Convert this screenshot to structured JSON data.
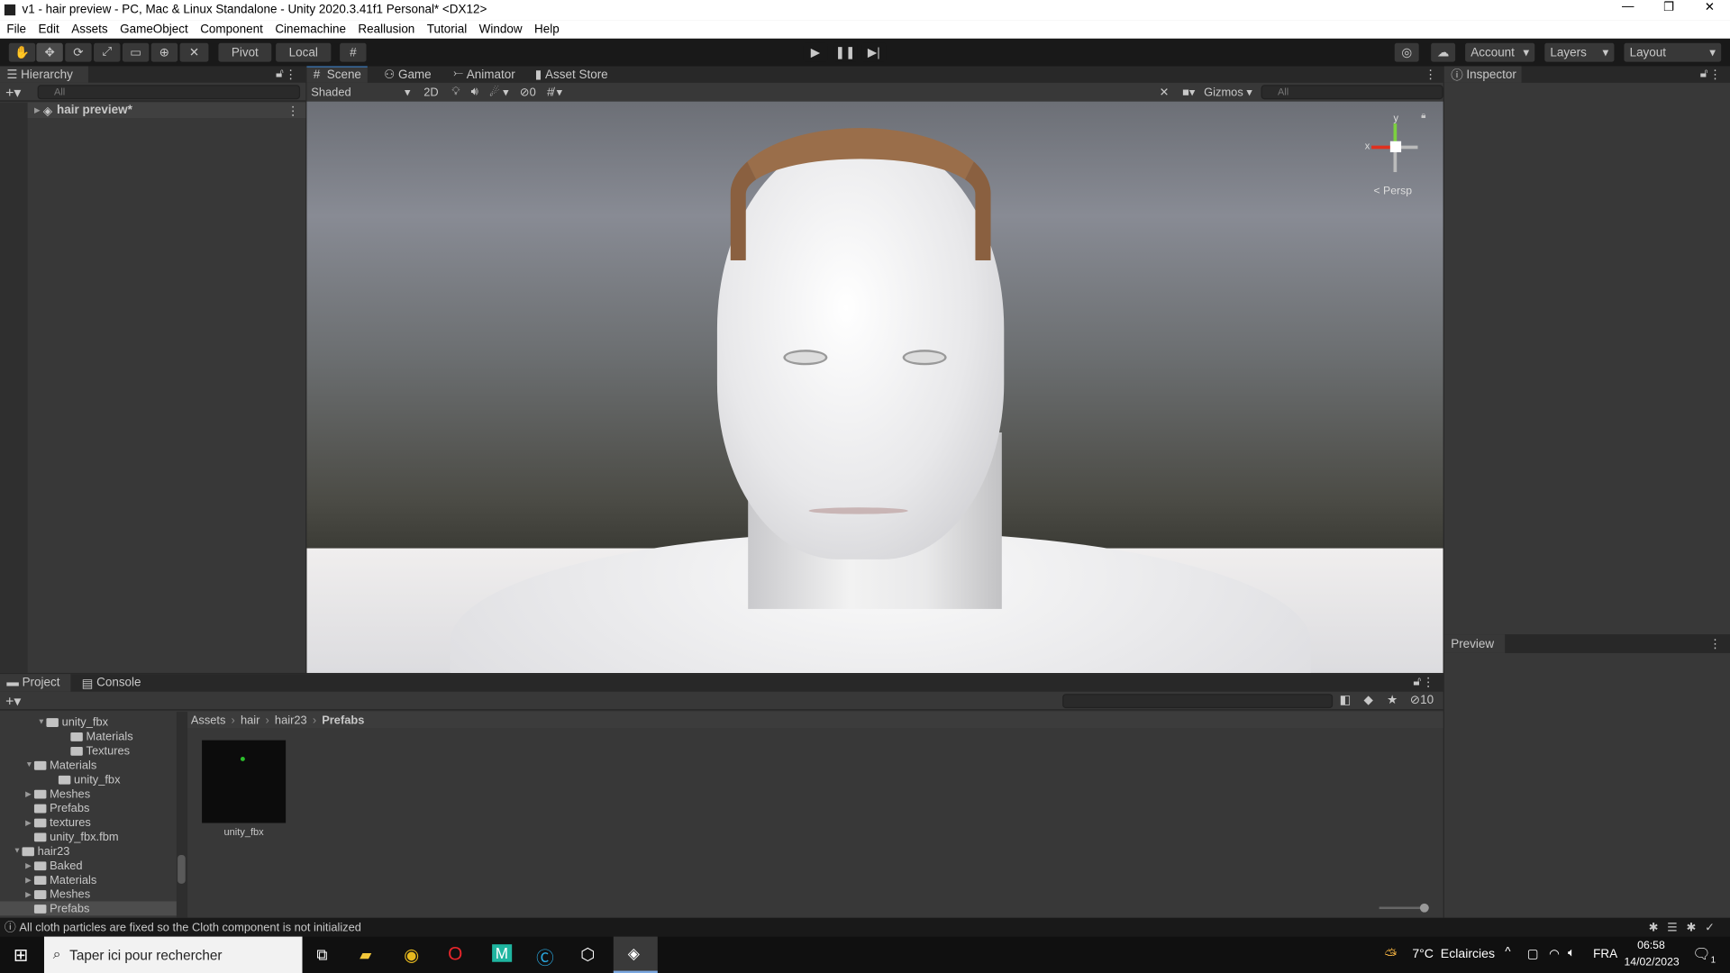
{
  "window": {
    "title": "v1 - hair preview - PC, Mac & Linux Standalone - Unity 2020.3.41f1 Personal* <DX12>",
    "minimize": "—",
    "restore": "❐",
    "close": "✕"
  },
  "menu": [
    "File",
    "Edit",
    "Assets",
    "GameObject",
    "Component",
    "Cinemachine",
    "Reallusion",
    "Tutorial",
    "Window",
    "Help"
  ],
  "toolbar": {
    "pivot": "Pivot",
    "local": "Local",
    "account": "Account",
    "layers": "Layers",
    "layout": "Layout"
  },
  "hierarchy": {
    "tab": "Hierarchy",
    "search_placeholder": "All",
    "root": "hair preview*"
  },
  "scene": {
    "tabs": [
      "Scene",
      "Game",
      "Animator",
      "Asset Store"
    ],
    "shading": "Shaded",
    "mode2d": "2D",
    "hidden_count": "0",
    "gizmos": "Gizmos",
    "search_placeholder": "All",
    "persp": "< Persp",
    "axis_x": "x",
    "axis_y": "y"
  },
  "inspector": {
    "tab": "Inspector",
    "preview": "Preview"
  },
  "project": {
    "tabs": [
      "Project",
      "Console"
    ],
    "hidden_count": "10",
    "tree": [
      {
        "label": "unity_fbx",
        "indent": 4,
        "arrow": "▼",
        "open": true
      },
      {
        "label": "Materials",
        "indent": 6
      },
      {
        "label": "Textures",
        "indent": 6
      },
      {
        "label": "Materials",
        "indent": 3,
        "arrow": "▼",
        "open": true
      },
      {
        "label": "unity_fbx",
        "indent": 5
      },
      {
        "label": "Meshes",
        "indent": 3,
        "arrow": "▶"
      },
      {
        "label": "Prefabs",
        "indent": 3
      },
      {
        "label": "textures",
        "indent": 3,
        "arrow": "▶"
      },
      {
        "label": "unity_fbx.fbm",
        "indent": 3
      },
      {
        "label": "hair23",
        "indent": 2,
        "arrow": "▼",
        "open": true
      },
      {
        "label": "Baked",
        "indent": 3,
        "arrow": "▶"
      },
      {
        "label": "Materials",
        "indent": 3,
        "arrow": "▶"
      },
      {
        "label": "Meshes",
        "indent": 3,
        "arrow": "▶"
      },
      {
        "label": "Prefabs",
        "indent": 3,
        "selected": true
      }
    ],
    "breadcrumb": [
      "Assets",
      "hair",
      "hair23",
      "Prefabs"
    ],
    "assets": [
      {
        "label": "unity_fbx"
      }
    ]
  },
  "status": {
    "message": "All cloth particles are fixed so the Cloth component is not initialized"
  },
  "taskbar": {
    "search_placeholder": "Taper ici pour rechercher",
    "weather": "7°C  Eclaircies",
    "lang": "FRA",
    "time": "06:58",
    "date": "14/02/2023",
    "notif": "1"
  }
}
